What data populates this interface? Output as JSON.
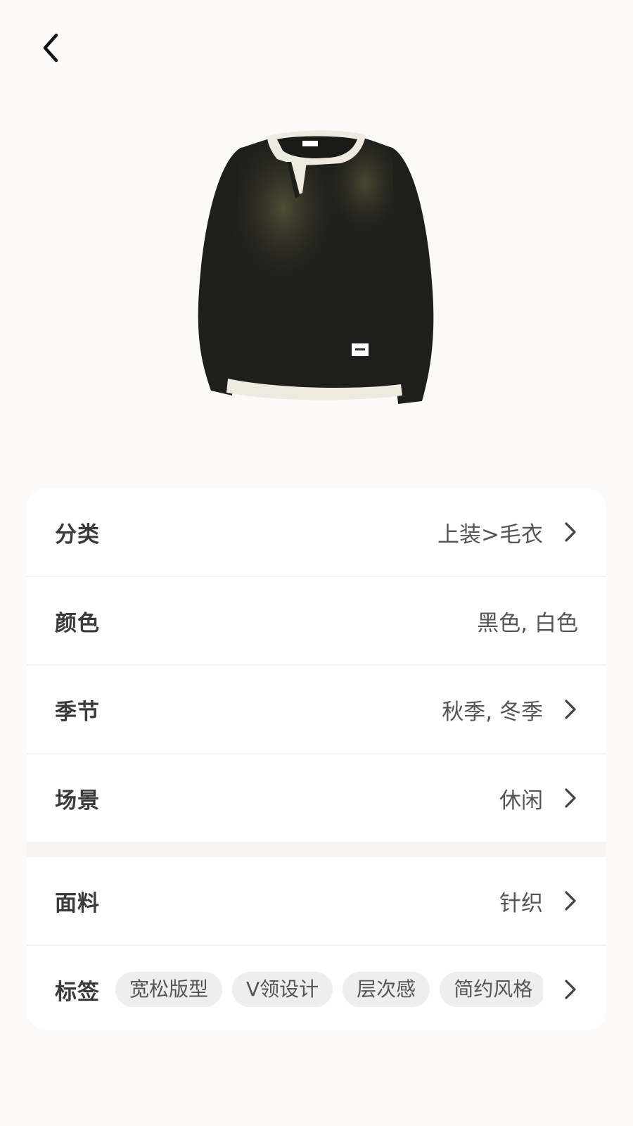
{
  "nav": {
    "back_icon": "chevron-left-icon"
  },
  "product": {
    "image": "black-knit-sweater-with-white-trim",
    "colors": {
      "body": "#1E1F1B",
      "trim": "#EEEAE0",
      "shade": "#4E4C36"
    }
  },
  "details": {
    "category": {
      "label": "分类",
      "value": "上装>毛衣"
    },
    "color": {
      "label": "颜色",
      "value": "黑色, 白色"
    },
    "season": {
      "label": "季节",
      "value": "秋季, 冬季"
    },
    "scene": {
      "label": "场景",
      "value": "休闲"
    },
    "fabric": {
      "label": "面料",
      "value": "针织"
    },
    "tags": {
      "label": "标签",
      "items": [
        "宽松版型",
        "V领设计",
        "层次感",
        "简约风格"
      ]
    }
  },
  "theme": {
    "background": "#FBFAF8",
    "card": "#FFFFFF",
    "tag_bg": "#EEEEEE",
    "text_primary": "#3A3A3A",
    "text_secondary": "#555555"
  }
}
